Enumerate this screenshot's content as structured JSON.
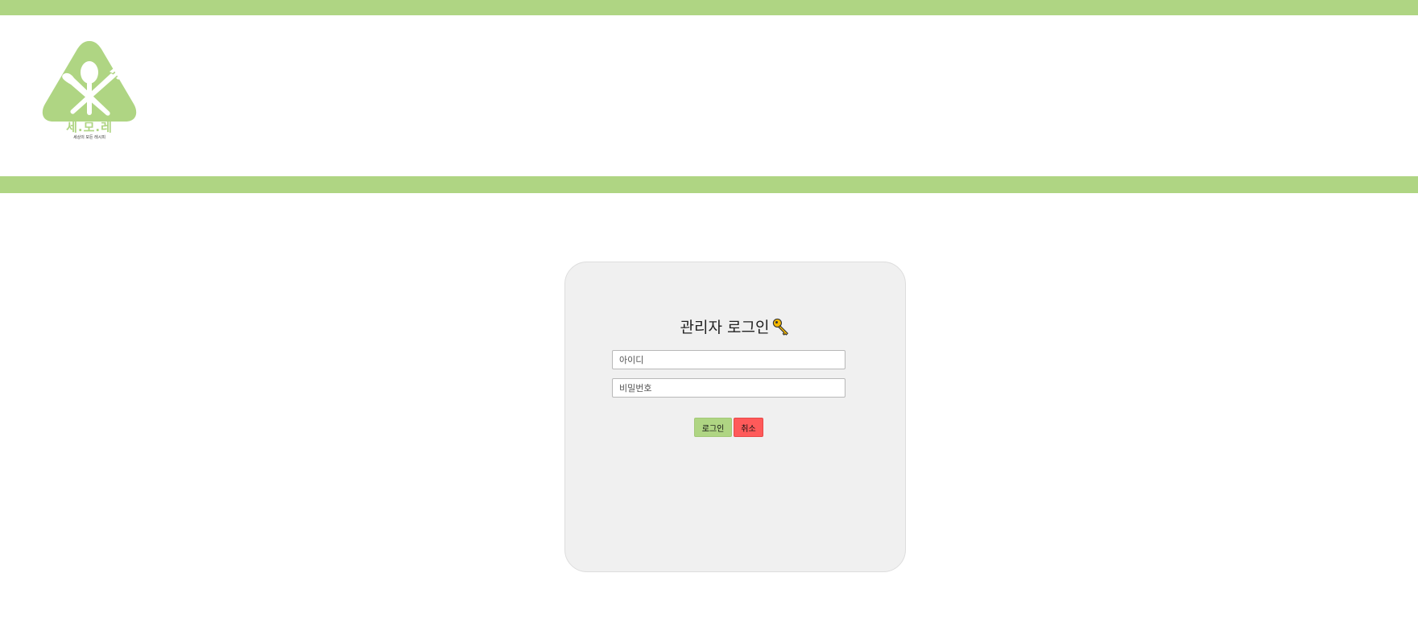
{
  "header": {
    "logo": {
      "title": "세.모.레",
      "subtitle": "세상의 모든 레시피"
    }
  },
  "login": {
    "title": "관리자 로그인",
    "title_icon": "key-icon",
    "id_placeholder": "아이디",
    "pw_placeholder": "비밀번호",
    "login_label": "로그인",
    "cancel_label": "취소"
  },
  "colors": {
    "accent": "#afd583",
    "card_bg": "#f0f0f0",
    "cancel": "#ff5a5a"
  }
}
